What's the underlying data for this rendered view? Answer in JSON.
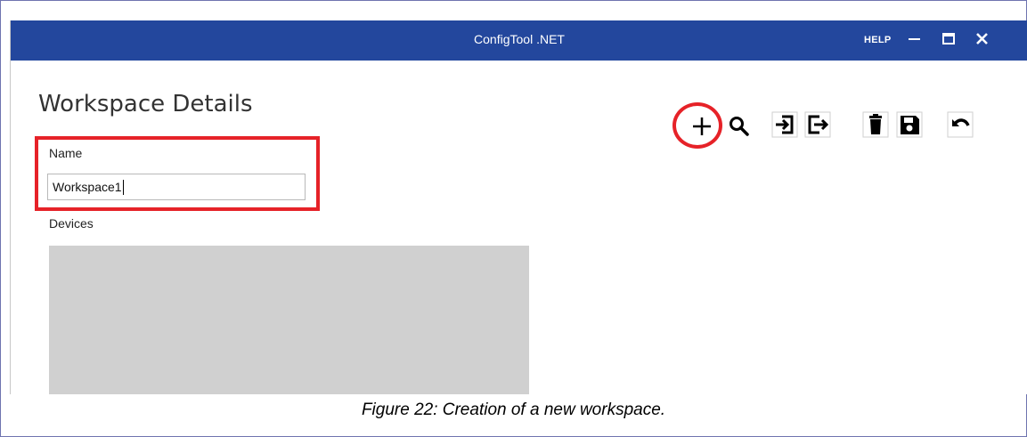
{
  "window": {
    "title": "ConfigTool .NET",
    "help_label": "HELP",
    "titlebar_color": "#23479d"
  },
  "page": {
    "title": "Workspace Details"
  },
  "form": {
    "name_label": "Name",
    "name_value": "Workspace1",
    "devices_label": "Devices"
  },
  "toolbar": {
    "icons": [
      "add-icon",
      "search-icon",
      "import-icon",
      "export-icon",
      "delete-icon",
      "save-icon",
      "undo-icon"
    ]
  },
  "annotations": {
    "highlight_color": "#e62228"
  },
  "caption": "Figure 22: Creation of a new workspace."
}
